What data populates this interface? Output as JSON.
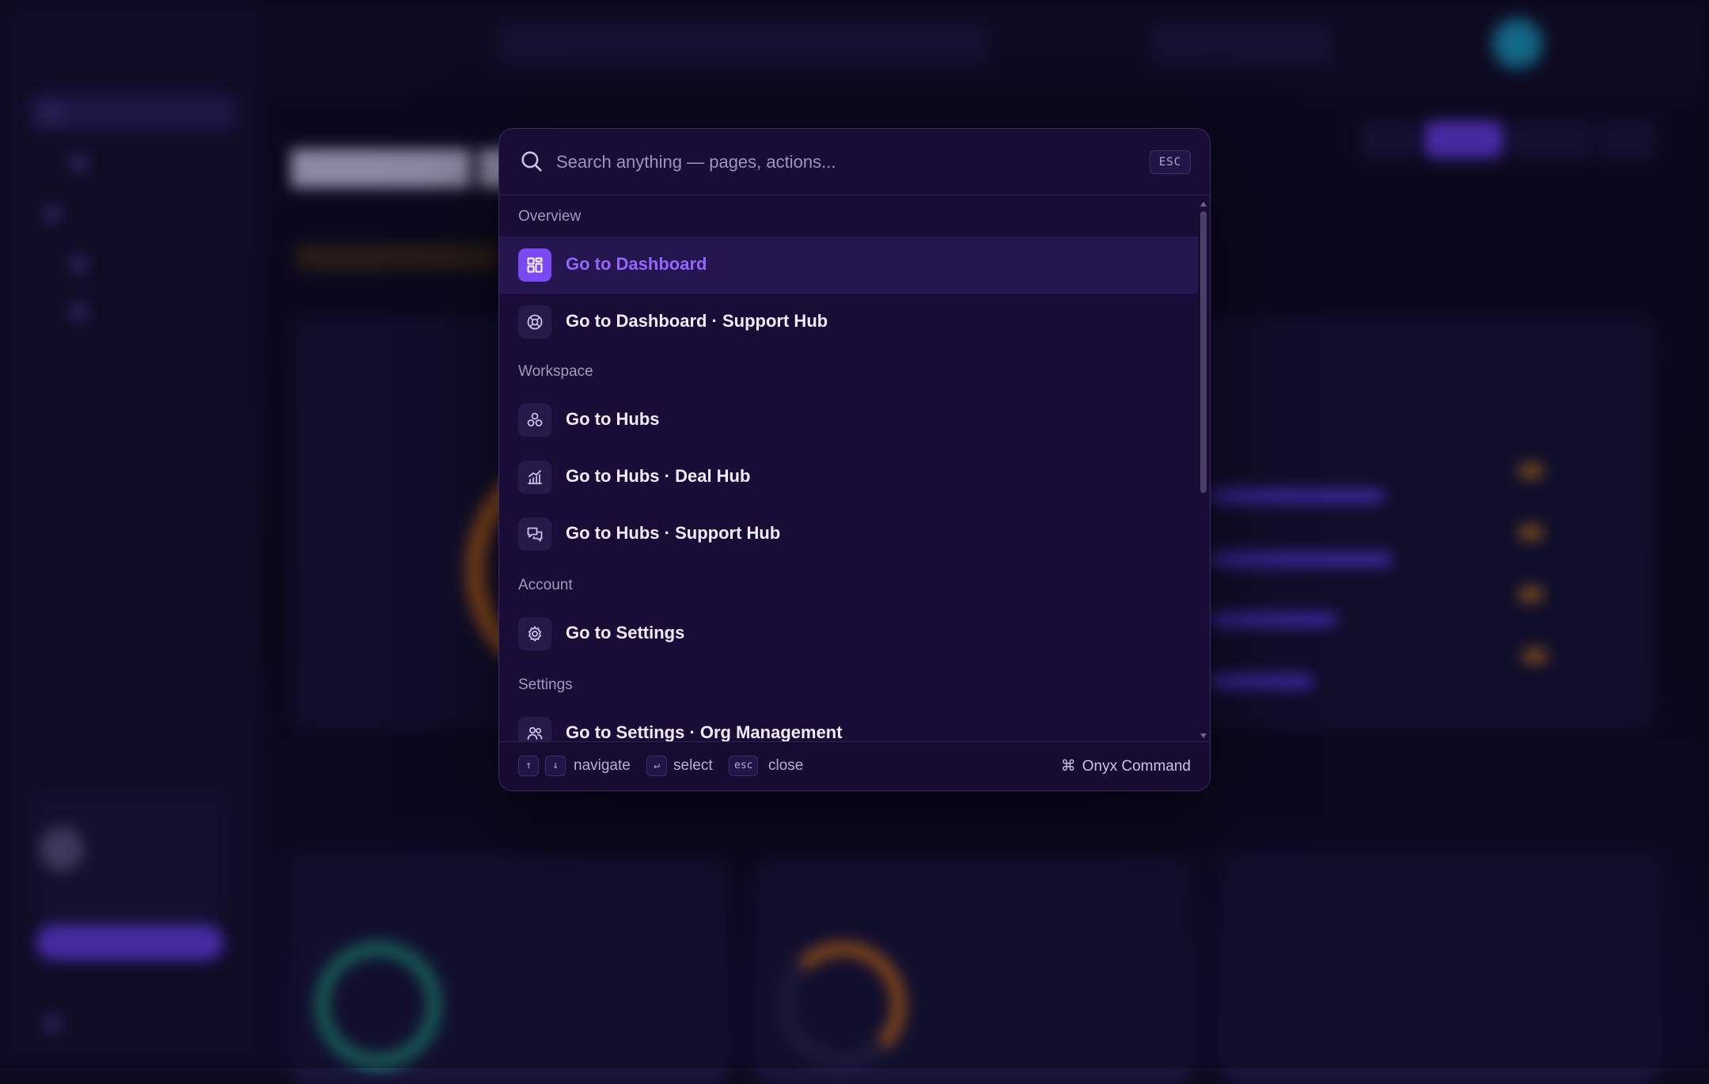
{
  "palette": {
    "search_placeholder": "Search anything — pages, actions...",
    "esc_label": "ESC",
    "groups": [
      {
        "label": "Overview"
      },
      {
        "label": "Workspace"
      },
      {
        "label": "Account"
      },
      {
        "label": "Settings"
      }
    ],
    "items": [
      {
        "label": "Go to Dashboard",
        "icon": "dashboard-grid-icon",
        "selected": true
      },
      {
        "label": "Go to Dashboard · Support Hub",
        "icon": "lifebuoy-icon",
        "selected": false
      },
      {
        "label": "Go to Hubs",
        "icon": "hubs-cluster-icon",
        "selected": false
      },
      {
        "label": "Go to Hubs · Deal Hub",
        "icon": "chart-trend-icon",
        "selected": false
      },
      {
        "label": "Go to Hubs · Support Hub",
        "icon": "chat-bubbles-icon",
        "selected": false
      },
      {
        "label": "Go to Settings",
        "icon": "gear-icon",
        "selected": false
      },
      {
        "label": "Go to Settings · Org Management",
        "icon": "users-icon",
        "selected": false
      }
    ],
    "footer": {
      "up_key": "↑",
      "down_key": "↓",
      "navigate": "navigate",
      "enter_key": "↵",
      "select": "select",
      "esc_key": "esc",
      "close": "close",
      "brand_symbol": "⌘",
      "brand": "Onyx Command"
    },
    "accent_color": "#7a4bf5",
    "selected_text_color": "#9267ff"
  }
}
